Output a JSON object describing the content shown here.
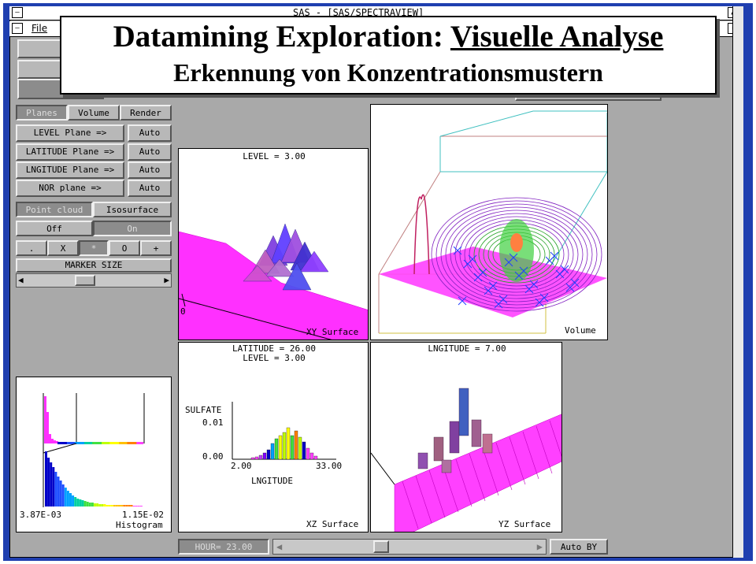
{
  "slide": {
    "title_part1": "Datamining Exploration: ",
    "title_part2": "Visuelle Analyse",
    "subtitle": "Erkennung von Konzentrationsmustern"
  },
  "window": {
    "title": "SAS - [SAS/SPECTRAVIEW]",
    "menu_file": "File"
  },
  "controls": {
    "tabs": [
      "Planes",
      "Volume",
      "Render"
    ],
    "plane_buttons": [
      "LEVEL Plane =>",
      "LATITUDE Plane =>",
      "LNGITUDE Plane =>",
      "NOR plane =>"
    ],
    "auto_labels": [
      "Auto",
      "Auto",
      "Auto",
      "Auto"
    ],
    "point_cloud": "Point cloud",
    "isosurface": "Isosurface",
    "off": "Off",
    "on": "On",
    "markers": [
      ".",
      "X",
      "*",
      "O",
      "+"
    ],
    "marker_size_label": "MARKER SIZE",
    "marker_size_fraction": 0.42
  },
  "views": {
    "xy": {
      "header": "LEVEL = 3.00",
      "footer": "XY Surface",
      "axis_tick": "0"
    },
    "volume": {
      "footer": "Volume"
    },
    "xz": {
      "header1": "LATITUDE = 26.00",
      "header2": "LEVEL = 3.00",
      "footer": "XZ Surface",
      "ylabel": "SULFATE",
      "ytick_top": "0.01",
      "ytick_bottom": "0.00",
      "xtick_left": "2.00",
      "xtick_right": "33.00",
      "xlabel": "LNGITUDE"
    },
    "yz": {
      "header": "LNGITUDE = 7.00",
      "footer": "YZ Surface"
    },
    "histogram": {
      "min": "3.87E-03",
      "max": "1.15E-02",
      "label": "Histogram"
    }
  },
  "bottom": {
    "hour": "HOUR= 23.00",
    "auto_by": "Auto BY",
    "slider_fraction": 0.37
  }
}
